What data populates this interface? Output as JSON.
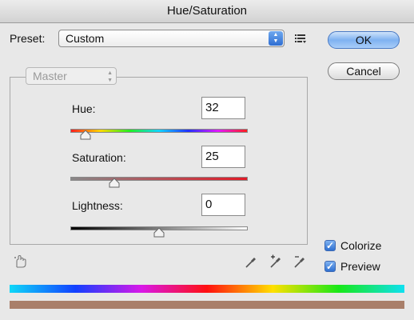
{
  "window": {
    "title": "Hue/Saturation"
  },
  "preset": {
    "label": "Preset:",
    "value": "Custom"
  },
  "buttons": {
    "ok": "OK",
    "cancel": "Cancel"
  },
  "edit_channel": {
    "value": "Master"
  },
  "sliders": {
    "hue": {
      "label": "Hue:",
      "value": "32",
      "min": -180,
      "max": 180
    },
    "saturation": {
      "label": "Saturation:",
      "value": "25",
      "min": 0,
      "max": 100
    },
    "lightness": {
      "label": "Lightness:",
      "value": "0",
      "min": -100,
      "max": 100
    }
  },
  "options": {
    "colorize": {
      "label": "Colorize",
      "checked": true
    },
    "preview": {
      "label": "Preview",
      "checked": true
    }
  },
  "colors": {
    "accent": "#2e6fd0",
    "result_color": "#a97f6a"
  },
  "icons": [
    "preset-options-icon",
    "targeted-adjustment-hand-icon",
    "eyedropper-icon",
    "eyedropper-add-icon",
    "eyedropper-subtract-icon"
  ]
}
